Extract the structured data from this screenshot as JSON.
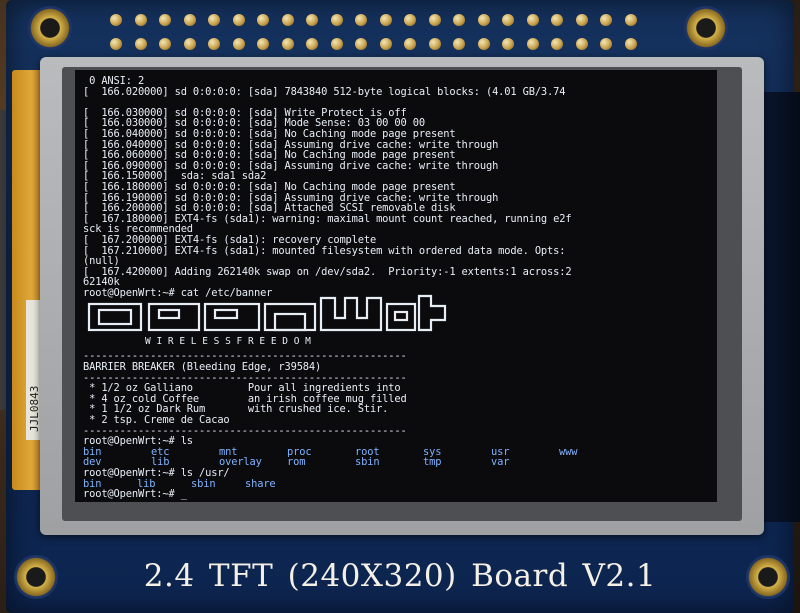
{
  "board_label": "2.4 TFT (240X320)   Board V2.1",
  "strip_label": "JJL0843",
  "terminal": {
    "lines": [
      {
        "text": " 0 ANSI: 2",
        "cls": ""
      },
      {
        "text": "[  166.020000] sd 0:0:0:0: [sda] 7843840 512-byte logical blocks: (4.01 GB/3.74",
        "cls": ""
      },
      {
        "text": "",
        "cls": ""
      },
      {
        "text": "[  166.030000] sd 0:0:0:0: [sda] Write Protect is off",
        "cls": ""
      },
      {
        "text": "[  166.030000] sd 0:0:0:0: [sda] Mode Sense: 03 00 00 00",
        "cls": ""
      },
      {
        "text": "[  166.040000] sd 0:0:0:0: [sda] No Caching mode page present",
        "cls": ""
      },
      {
        "text": "[  166.040000] sd 0:0:0:0: [sda] Assuming drive cache: write through",
        "cls": ""
      },
      {
        "text": "[  166.060000] sd 0:0:0:0: [sda] No Caching mode page present",
        "cls": ""
      },
      {
        "text": "[  166.090000] sd 0:0:0:0: [sda] Assuming drive cache: write through",
        "cls": ""
      },
      {
        "text": "[  166.150000]  sda: sda1 sda2",
        "cls": ""
      },
      {
        "text": "[  166.180000] sd 0:0:0:0: [sda] No Caching mode page present",
        "cls": ""
      },
      {
        "text": "[  166.190000] sd 0:0:0:0: [sda] Assuming drive cache: write through",
        "cls": ""
      },
      {
        "text": "[  166.200000] sd 0:0:0:0: [sda] Attached SCSI removable disk",
        "cls": ""
      },
      {
        "text": "[  167.180000] EXT4-fs (sda1): warning: maximal mount count reached, running e2f",
        "cls": ""
      },
      {
        "text": "sck is recommended",
        "cls": ""
      },
      {
        "text": "[  167.200000] EXT4-fs (sda1): recovery complete",
        "cls": ""
      },
      {
        "text": "[  167.210000] EXT4-fs (sda1): mounted filesystem with ordered data mode. Opts:",
        "cls": ""
      },
      {
        "text": "(null)",
        "cls": ""
      },
      {
        "text": "[  167.420000] Adding 262140k swap on /dev/sda2.  Priority:-1 extents:1 across:2",
        "cls": ""
      },
      {
        "text": "62140k",
        "cls": ""
      },
      {
        "text": "root@OpenWrt:~# cat /etc/banner",
        "cls": ""
      }
    ],
    "banner_subtitle": "W I R E L E S S   F R E E D O M",
    "lines2": [
      {
        "text": "-----------------------------------------------------",
        "cls": ""
      },
      {
        "text": "BARRIER BREAKER (Bleeding Edge, r39584)",
        "cls": ""
      },
      {
        "text": "-----------------------------------------------------",
        "cls": ""
      },
      {
        "text": " * 1/2 oz Galliano         Pour all ingredients into",
        "cls": ""
      },
      {
        "text": " * 4 oz cold Coffee        an irish coffee mug filled",
        "cls": ""
      },
      {
        "text": " * 1 1/2 oz Dark Rum       with crushed ice. Stir.",
        "cls": ""
      },
      {
        "text": " * 2 tsp. Creme de Cacao",
        "cls": ""
      },
      {
        "text": "-----------------------------------------------------",
        "cls": ""
      },
      {
        "text": "root@OpenWrt:~# ls",
        "cls": ""
      }
    ],
    "ls_rows": [
      [
        "bin",
        "etc",
        "mnt",
        "proc",
        "root",
        "sys",
        "usr",
        "www"
      ],
      [
        "dev",
        "lib",
        "overlay",
        "rom",
        "sbin",
        "tmp",
        "var",
        ""
      ]
    ],
    "prompt3": "root@OpenWrt:~# ls /usr/",
    "usr_row": [
      "bin",
      "lib",
      "sbin",
      "share"
    ],
    "prompt4": "root@OpenWrt:~# _"
  }
}
